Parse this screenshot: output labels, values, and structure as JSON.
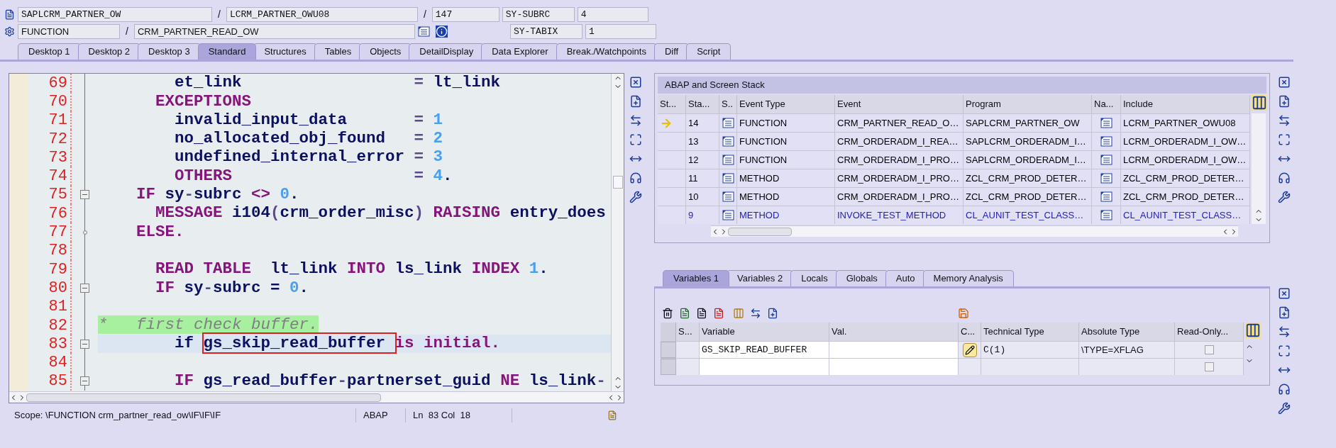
{
  "header": {
    "program": "SAPLCRM_PARTNER_OW",
    "include": "LCRM_PARTNER_OWU08",
    "line": "147",
    "event_type": "FUNCTION",
    "event": "CRM_PARTNER_READ_OW",
    "separators": [
      "/",
      "/",
      "/"
    ],
    "sysfields": [
      {
        "name": "SY-SUBRC",
        "value": "4"
      },
      {
        "name": "SY-TABIX",
        "value": "1"
      }
    ]
  },
  "tabs": [
    {
      "label": "Desktop 1",
      "selected": false
    },
    {
      "label": "Desktop 2",
      "selected": false
    },
    {
      "label": "Desktop 3",
      "selected": false
    },
    {
      "label": "Standard",
      "selected": true
    },
    {
      "label": "Structures",
      "selected": false
    },
    {
      "label": "Tables",
      "selected": false
    },
    {
      "label": "Objects",
      "selected": false
    },
    {
      "label": "DetailDisplay",
      "selected": false
    },
    {
      "label": "Data Explorer",
      "selected": false
    },
    {
      "label": "Break./Watchpoints",
      "selected": false
    },
    {
      "label": "Diff",
      "selected": false
    },
    {
      "label": "Script",
      "selected": false
    }
  ],
  "editor": {
    "lines": [
      {
        "number": "69",
        "current": false,
        "tokens": [
          {
            "text": "        et_link",
            "kind": "id"
          },
          {
            "text": "                  = ",
            "kind": "op"
          },
          {
            "text": "lt_link",
            "kind": "id"
          }
        ]
      },
      {
        "number": "70",
        "current": false,
        "tokens": [
          {
            "text": "      EXCEPTIONS",
            "kind": "kw"
          }
        ]
      },
      {
        "number": "71",
        "current": false,
        "tokens": [
          {
            "text": "        invalid_input_data",
            "kind": "id"
          },
          {
            "text": "       = ",
            "kind": "op"
          },
          {
            "text": "1",
            "kind": "num"
          }
        ]
      },
      {
        "number": "72",
        "current": false,
        "tokens": [
          {
            "text": "        no_allocated_obj_found",
            "kind": "id"
          },
          {
            "text": "   = ",
            "kind": "op"
          },
          {
            "text": "2",
            "kind": "num"
          }
        ]
      },
      {
        "number": "73",
        "current": false,
        "tokens": [
          {
            "text": "        undefined_internal_error",
            "kind": "id"
          },
          {
            "text": " = ",
            "kind": "op"
          },
          {
            "text": "3",
            "kind": "num"
          }
        ]
      },
      {
        "number": "74",
        "current": false,
        "tokens": [
          {
            "text": "        OTHERS",
            "kind": "kw"
          },
          {
            "text": "                   = ",
            "kind": "op"
          },
          {
            "text": "4",
            "kind": "num"
          },
          {
            "text": ".",
            "kind": "id"
          }
        ]
      },
      {
        "number": "75",
        "current": false,
        "fold": {
          "kind": "minus"
        },
        "tokens": [
          {
            "text": "    IF",
            "kind": "kw"
          },
          {
            "text": " sy",
            "kind": "id"
          },
          {
            "text": "-",
            "kind": "op"
          },
          {
            "text": "subrc",
            "kind": "id"
          },
          {
            "text": " <> ",
            "kind": "kw"
          },
          {
            "text": "0",
            "kind": "num"
          },
          {
            "text": ".",
            "kind": "id"
          }
        ]
      },
      {
        "number": "76",
        "current": false,
        "tokens": [
          {
            "text": "      MESSAGE",
            "kind": "kw"
          },
          {
            "text": " i104",
            "kind": "id"
          },
          {
            "text": "(",
            "kind": "op"
          },
          {
            "text": "crm_order_misc",
            "kind": "id"
          },
          {
            "text": ")",
            "kind": "op"
          },
          {
            "text": " RAISING",
            "kind": "kw"
          },
          {
            "text": " entry_does",
            "kind": "id"
          }
        ]
      },
      {
        "number": "77",
        "current": false,
        "fold": {
          "kind": "dot"
        },
        "tokens": [
          {
            "text": "    ELSE.",
            "kind": "kw"
          }
        ]
      },
      {
        "number": "78",
        "current": false
      },
      {
        "number": "79",
        "current": false,
        "tokens": [
          {
            "text": "      READ TABLE",
            "kind": "kw"
          },
          {
            "text": "  lt_link",
            "kind": "id"
          },
          {
            "text": " INTO",
            "kind": "kw"
          },
          {
            "text": " ls_link",
            "kind": "id"
          },
          {
            "text": " INDEX",
            "kind": "kw"
          },
          {
            "text": " 1",
            "kind": "num"
          },
          {
            "text": ".",
            "kind": "id"
          }
        ]
      },
      {
        "number": "80",
        "current": false,
        "fold": {
          "kind": "minus"
        },
        "tokens": [
          {
            "text": "      IF",
            "kind": "kw"
          },
          {
            "text": " sy",
            "kind": "id"
          },
          {
            "text": "-",
            "kind": "op"
          },
          {
            "text": "subrc",
            "kind": "id"
          },
          {
            "text": " = ",
            "kind": "id"
          },
          {
            "text": "0",
            "kind": "num"
          },
          {
            "text": ".",
            "kind": "id"
          }
        ]
      },
      {
        "number": "81",
        "current": false
      },
      {
        "number": "82",
        "current": false,
        "tokens": [
          {
            "text": "*   first check buffer.",
            "kind": "comment"
          }
        ]
      },
      {
        "number": "83",
        "current": true,
        "fold": {
          "kind": "minus"
        },
        "tokens": [
          {
            "text": "        if ",
            "kind": "id"
          },
          {
            "text": "gs_skip_read_buffer ",
            "kind": "boxed"
          },
          {
            "text": "is initial.",
            "kind": "kw"
          }
        ]
      },
      {
        "number": "84",
        "current": false
      },
      {
        "number": "85",
        "current": false,
        "fold": {
          "kind": "minus"
        },
        "tokens": [
          {
            "text": "        IF",
            "kind": "kw"
          },
          {
            "text": " gs_read_buffer",
            "kind": "id"
          },
          {
            "text": "-",
            "kind": "op"
          },
          {
            "text": "partnerset_guid",
            "kind": "id"
          },
          {
            "text": " NE",
            "kind": "kw"
          },
          {
            "text": " ls_link",
            "kind": "id"
          },
          {
            "text": "-",
            "kind": "op"
          }
        ]
      }
    ]
  },
  "stack": {
    "title": "ABAP and Screen Stack",
    "columns": [
      "St...",
      "Sta...",
      "S..",
      "Event Type",
      "Event",
      "Program",
      "Na...",
      "Include"
    ],
    "rows": [
      {
        "current": true,
        "level": "14",
        "event_type": "FUNCTION",
        "event": "CRM_PARTNER_READ_O…",
        "program": "SAPLCRM_PARTNER_OW",
        "include": "LCRM_PARTNER_OWU08",
        "color": "#000000"
      },
      {
        "current": false,
        "level": "13",
        "event_type": "FUNCTION",
        "event": "CRM_ORDERADM_I_REA…",
        "program": "SAPLCRM_ORDERADM_I…",
        "include": "LCRM_ORDERADM_I_OW…",
        "color": "#000000"
      },
      {
        "current": false,
        "level": "12",
        "event_type": "FUNCTION",
        "event": "CRM_ORDERADM_I_PRO…",
        "program": "SAPLCRM_ORDERADM_I…",
        "include": "LCRM_ORDERADM_I_OW…",
        "color": "#000000"
      },
      {
        "current": false,
        "level": "11",
        "event_type": "METHOD",
        "event": "CRM_ORDERADM_I_PRO…",
        "program": "ZCL_CRM_PROD_DETER…",
        "include": "ZCL_CRM_PROD_DETER…",
        "color": "#000000"
      },
      {
        "current": false,
        "level": "10",
        "event_type": "METHOD",
        "event": "CRM_ORDERADM_I_PRO…",
        "program": "ZCL_CRM_PROD_DETER…",
        "include": "ZCL_CRM_PROD_DETER…",
        "color": "#000000"
      },
      {
        "current": false,
        "level": "9",
        "event_type": "METHOD",
        "event": "INVOKE_TEST_METHOD",
        "program": "CL_AUNIT_TEST_CLASS…",
        "include": "CL_AUNIT_TEST_CLASS…",
        "color": "#1c1cc0"
      }
    ]
  },
  "variables": {
    "tabs": [
      {
        "label": "Variables 1",
        "selected": true
      },
      {
        "label": "Variables 2",
        "selected": false
      },
      {
        "label": "Locals",
        "selected": false
      },
      {
        "label": "Globals",
        "selected": false
      },
      {
        "label": "Auto",
        "selected": false
      },
      {
        "label": "Memory Analysis",
        "selected": false
      }
    ],
    "columns": [
      "S...",
      "Variable",
      "Val.",
      "C...",
      "Technical Type",
      "Absolute Type",
      "Read-Only..."
    ],
    "rows": [
      {
        "variable": "GS_SKIP_READ_BUFFER",
        "technical_type": "C(1)",
        "absolute_type": "\\TYPE=XFLAG",
        "read_only": false
      },
      {
        "read_only": false
      }
    ]
  },
  "status": {
    "scope": "Scope: \\FUNCTION crm_partner_read_ow\\IF\\IF\\IF",
    "language": "ABAP",
    "position": "Ln  83 Col  18"
  }
}
